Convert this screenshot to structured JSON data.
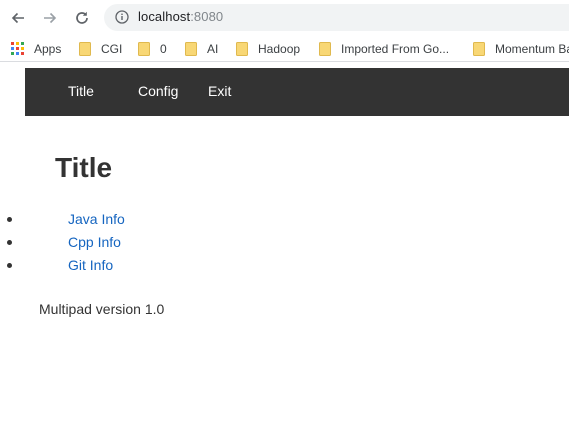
{
  "browser": {
    "url_host": "localhost",
    "url_port": ":8080",
    "icons": {
      "back": "arrow-left-icon",
      "forward": "arrow-right-icon",
      "reload": "reload-icon",
      "site_info": "info-circle-icon"
    }
  },
  "bookmarks": {
    "apps_label": "Apps",
    "items": [
      {
        "label": "CGI"
      },
      {
        "label": "0"
      },
      {
        "label": "AI"
      },
      {
        "label": "Hadoop"
      },
      {
        "label": "Imported From Go..."
      },
      {
        "label": "Momentum Ba"
      }
    ],
    "folder_color": "#f8d775"
  },
  "navbar": {
    "background": "#333333",
    "links": [
      {
        "label": "Title"
      },
      {
        "label": "Config"
      },
      {
        "label": "Exit"
      }
    ]
  },
  "main": {
    "title": "Title",
    "links": [
      {
        "label": "Java Info"
      },
      {
        "label": "Cpp Info"
      },
      {
        "label": "Git Info"
      }
    ],
    "link_color": "#1565c0",
    "version_text": "Multipad version 1.0"
  }
}
